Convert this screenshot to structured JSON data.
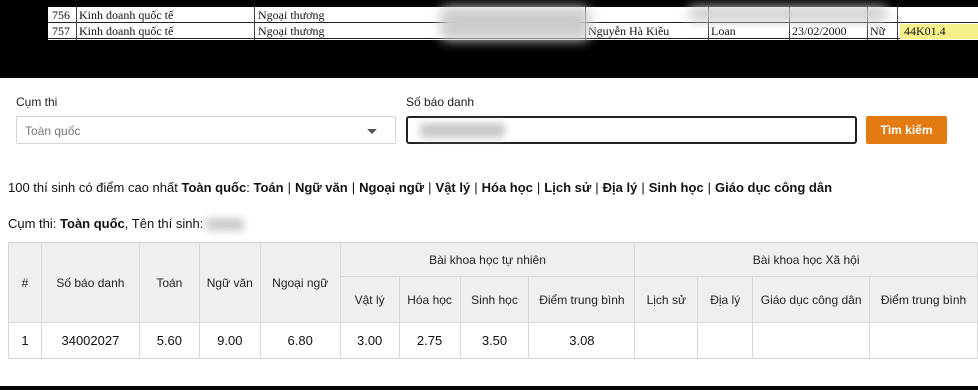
{
  "sheet": {
    "rows": [
      {
        "no": "756",
        "major": "Kinh doanh quốc tế",
        "school": "Ngoại thương",
        "name": "",
        "first": "",
        "dob": "",
        "gender": "",
        "class": ""
      },
      {
        "no": "757",
        "major": "Kinh doanh quốc tế",
        "school": "Ngoại thương",
        "name": "Nguyễn Hà Kiều",
        "first": "Loan",
        "dob": "23/02/2000",
        "gender": "Nữ",
        "class": "44K01.4"
      }
    ]
  },
  "form": {
    "cumthi_label": "Cụm thi",
    "cumthi_value": "Toàn quốc",
    "sbd_label": "Số báo danh",
    "search_button": "Tìm kiếm"
  },
  "top100": {
    "prefix": "100 thí sinh có điểm cao nhất",
    "scope": "Toàn quốc",
    "links": [
      "Toán",
      "Ngữ văn",
      "Ngoại ngữ",
      "Vật lý",
      "Hóa học",
      "Lịch sử",
      "Địa lý",
      "Sinh học",
      "Giáo dục công dân"
    ]
  },
  "candidate": {
    "cumthi_label": "Cụm thi:",
    "cumthi_value": "Toàn quốc",
    "name_label": ", Tên thí sinh:"
  },
  "table": {
    "headers": {
      "hash": "#",
      "sbd": "Số báo danh",
      "toan": "Toán",
      "nguvan": "Ngữ văn",
      "ngoaingu": "Ngoại ngữ",
      "khtn": "Bài khoa học tự nhiên",
      "khxh": "Bài khoa học Xã hội",
      "vatly": "Vật lý",
      "hoahoc": "Hóa học",
      "sinhhoc": "Sinh học",
      "dtb_tn": "Điểm trung bình",
      "lichsu": "Lịch sử",
      "dialy": "Địa lý",
      "gdcd": "Giáo dục công dân",
      "dtb_xh": "Điểm trung bình"
    },
    "row": {
      "idx": "1",
      "sbd": "34002027",
      "toan": "5.60",
      "nguvan": "9.00",
      "ngoaingu": "6.80",
      "vatly": "3.00",
      "hoahoc": "2.75",
      "sinhhoc": "3.50",
      "dtb_tn": "3.08",
      "lichsu": "",
      "dialy": "",
      "gdcd": "",
      "dtb_xh": ""
    }
  },
  "colors": {
    "search_button": "#e47a12",
    "highlight_cell": "#f6f08a",
    "header_bg": "#efefef"
  }
}
